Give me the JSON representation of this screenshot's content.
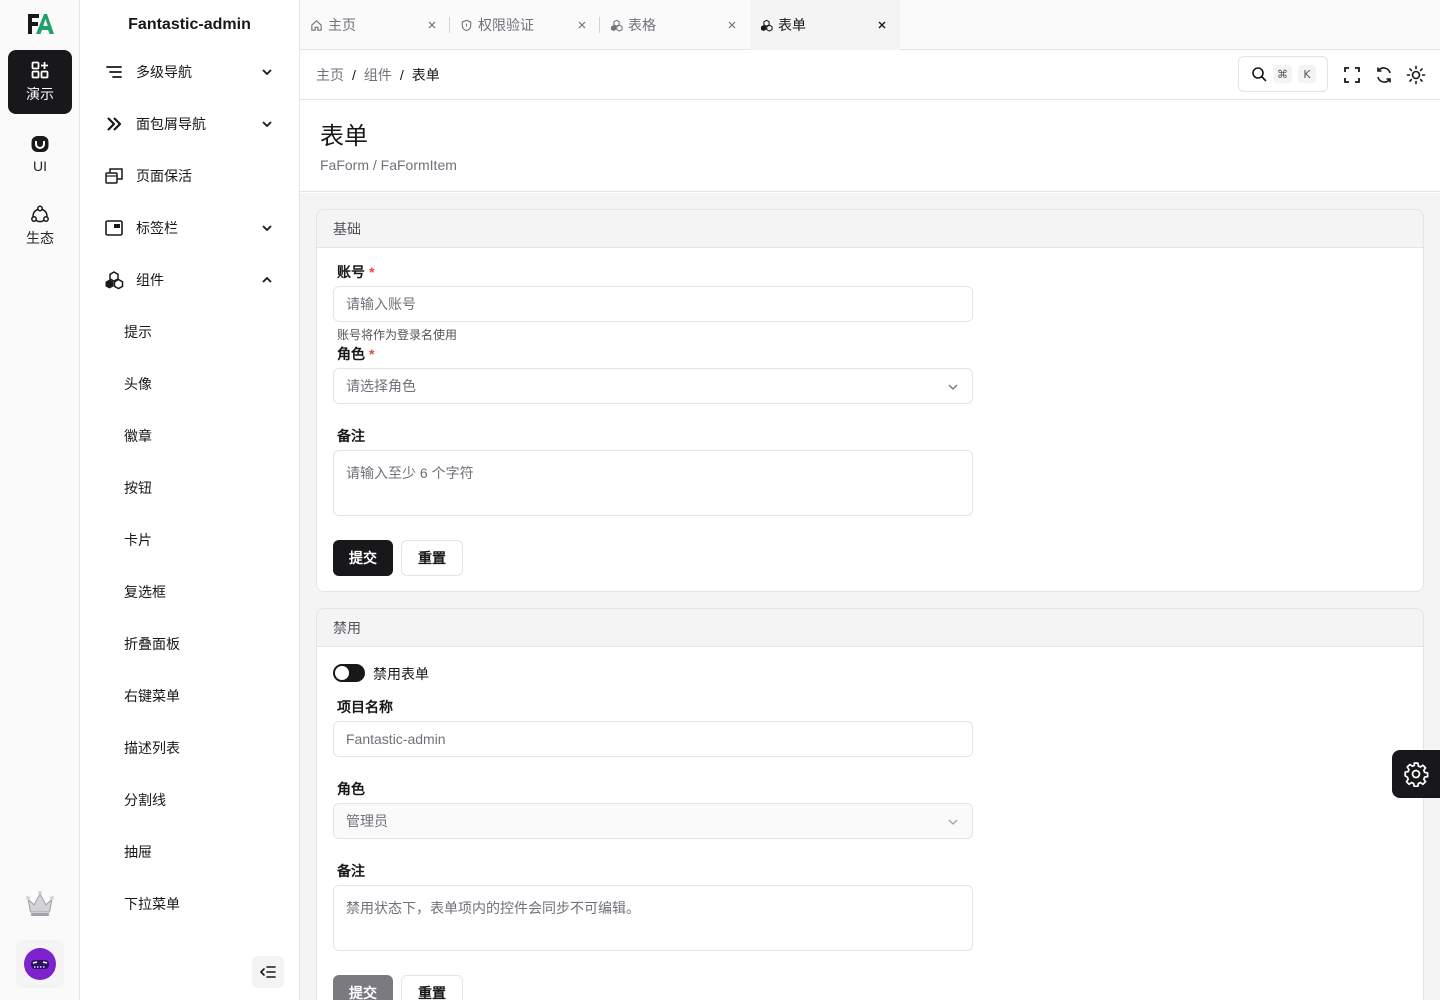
{
  "app": {
    "name": "Fantastic-admin"
  },
  "rail": {
    "items": [
      {
        "label": "演示",
        "icon": "apps-icon",
        "active": true
      },
      {
        "label": "UI",
        "icon": "ui-icon",
        "active": false
      },
      {
        "label": "生态",
        "icon": "ecosystem-icon",
        "active": false
      }
    ]
  },
  "sidebar": {
    "groups": [
      {
        "label": "多级导航",
        "icon": "menu-lines-icon",
        "expandable": true,
        "expanded": false
      },
      {
        "label": "面包屑导航",
        "icon": "double-chevron-right-icon",
        "expandable": true,
        "expanded": false
      },
      {
        "label": "页面保活",
        "icon": "windows-icon",
        "expandable": false
      },
      {
        "label": "标签栏",
        "icon": "tab-window-icon",
        "expandable": true,
        "expanded": false
      },
      {
        "label": "组件",
        "icon": "components-icon",
        "expandable": true,
        "expanded": true
      }
    ],
    "sub_items": [
      "提示",
      "头像",
      "徽章",
      "按钮",
      "卡片",
      "复选框",
      "折叠面板",
      "右键菜单",
      "描述列表",
      "分割线",
      "抽屉",
      "下拉菜单"
    ]
  },
  "tabs": [
    {
      "label": "主页",
      "icon": "home-icon",
      "active": false
    },
    {
      "label": "权限验证",
      "icon": "shield-icon",
      "active": false
    },
    {
      "label": "表格",
      "icon": "components-icon",
      "active": false
    },
    {
      "label": "表单",
      "icon": "components-icon",
      "active": true
    }
  ],
  "breadcrumb": {
    "items": [
      "主页",
      "组件",
      "表单"
    ],
    "separator": "/"
  },
  "search": {
    "shortcut_mod": "⌘",
    "shortcut_key": "K"
  },
  "page": {
    "title": "表单",
    "description": "FaForm / FaFormItem"
  },
  "form_basic": {
    "section_title": "基础",
    "account_label": "账号",
    "account_placeholder": "请输入账号",
    "account_help": "账号将作为登录名使用",
    "role_label": "角色",
    "role_placeholder": "请选择角色",
    "remark_label": "备注",
    "remark_placeholder": "请输入至少 6 个字符",
    "required_mark": "*",
    "submit_label": "提交",
    "reset_label": "重置"
  },
  "form_disabled": {
    "section_title": "禁用",
    "switch_label": "禁用表单",
    "switch_on": false,
    "project_label": "项目名称",
    "project_value": "Fantastic-admin",
    "role_label": "角色",
    "role_value": "管理员",
    "remark_label": "备注",
    "remark_placeholder": "禁用状态下，表单项内的控件会同步不可编辑。",
    "submit_label": "提交",
    "reset_label": "重置"
  },
  "colors": {
    "primary": "#18181b",
    "required": "#ef4444",
    "border": "#e4e4e7",
    "muted_text": "#71717a",
    "content_bg": "#f4f4f5"
  }
}
